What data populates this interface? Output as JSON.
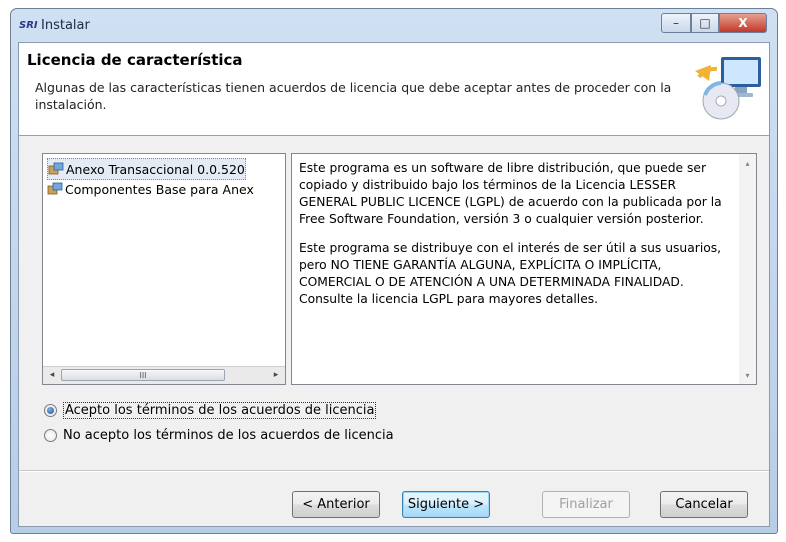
{
  "window": {
    "title": "Instalar",
    "app_icon_text": "SRI",
    "controls": {
      "minimize": "–",
      "maximize": "□",
      "close": "X"
    }
  },
  "header": {
    "title": "Licencia de característica",
    "description": "Algunas de las características tienen acuerdos de licencia que debe aceptar antes de proceder con la instalación.",
    "icon": "installer-cd-monitor-icon"
  },
  "features": {
    "items": [
      {
        "label": "Anexo Transaccional 0.0.520",
        "icon": "package-icon",
        "selected": true
      },
      {
        "label": "Componentes Base para Anex",
        "icon": "package-icon",
        "selected": false
      }
    ],
    "scrollbar": {
      "left_arrow": "◂",
      "right_arrow": "▸",
      "thumb_grip": "III"
    }
  },
  "license": {
    "paragraphs": [
      "Este programa es un software de libre distribución, que puede ser copiado y distribuido bajo los términos de la Licencia LESSER GENERAL PUBLIC LICENCE (LGPL) de acuerdo con la publicada por la Free Software Foundation, versión 3 o cualquier versión posterior.",
      "Este programa se distribuye con el interés de ser útil a sus usuarios, pero NO TIENE GARANTÍA ALGUNA, EXPLÍCITA O IMPLÍCITA, COMERCIAL O DE ATENCIÓN A UNA DETERMINADA FINALIDAD. Consulte la licencia LGPL para mayores detalles."
    ],
    "scrollbar": {
      "up_arrow": "▴",
      "down_arrow": "▾"
    }
  },
  "options": {
    "accept": {
      "label": "Acepto los términos de los acuerdos de licencia",
      "selected": true
    },
    "decline": {
      "label": "No acepto los términos de los acuerdos de licencia",
      "selected": false
    }
  },
  "buttons": {
    "back": "< Anterior",
    "next": "Siguiente >",
    "finish": "Finalizar",
    "cancel": "Cancelar"
  }
}
